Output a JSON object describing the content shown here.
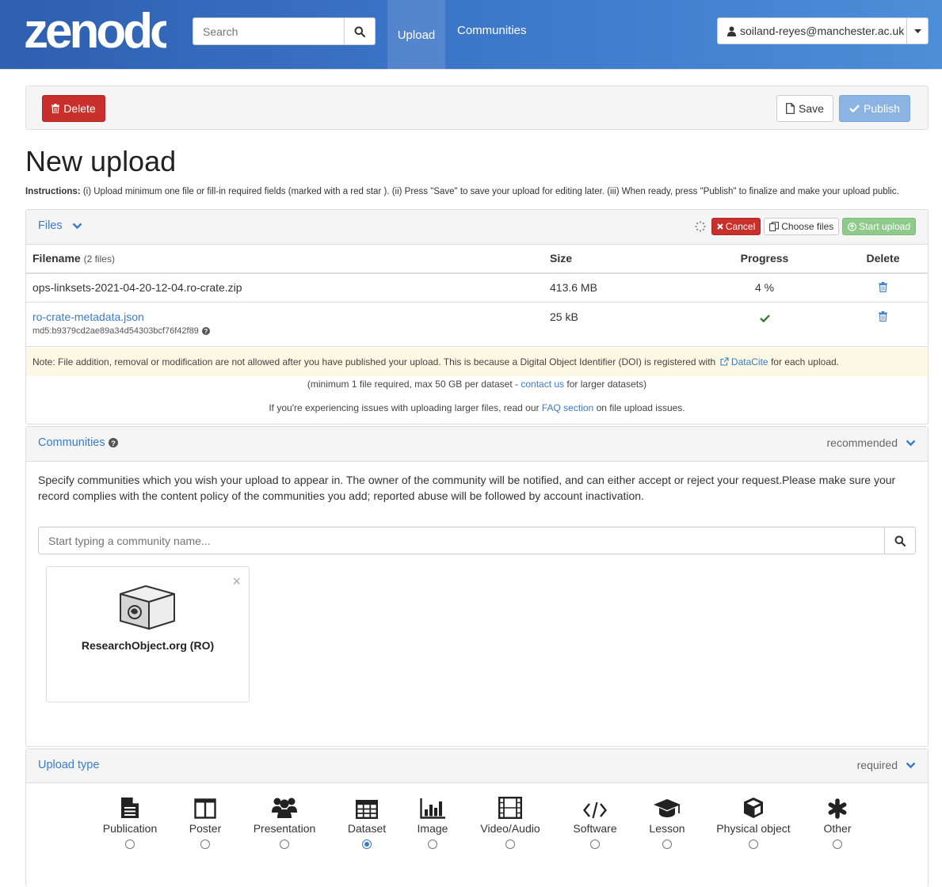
{
  "header": {
    "logo_text": "zenodo",
    "search_placeholder": "Search",
    "nav_upload": "Upload",
    "nav_communities": "Communities",
    "user_email": "soiland-reyes@manchester.ac.uk"
  },
  "actions": {
    "delete_label": "Delete",
    "save_label": "Save",
    "publish_label": "Publish"
  },
  "page": {
    "title": "New upload",
    "instructions_label": "Instructions:",
    "instructions_text": "(i) Upload minimum one file or fill-in required fields (marked with a red star ). (ii) Press \"Save\" to save your upload for editing later. (iii) When ready, press \"Publish\" to finalize and make your upload public."
  },
  "files": {
    "panel_title": "Files",
    "cancel_label": "Cancel",
    "choose_label": "Choose files",
    "start_label": "Start upload",
    "columns": {
      "filename": "Filename",
      "filecount": "(2 files)",
      "size": "Size",
      "progress": "Progress",
      "delete": "Delete"
    },
    "rows": [
      {
        "name": "ops-linksets-2021-04-20-12-04.ro-crate.zip",
        "size": "413.6 MB",
        "progress": "4 %"
      },
      {
        "name": "ro-crate-metadata.json",
        "md5": "md5:b9379cd2ae89a34d54303bcf76f42f89",
        "size": "25 kB",
        "progress": "done"
      }
    ],
    "note_prefix": "Note: File addition, removal or modification are not allowed after you have published your upload. This is because a Digital Object Identifier (DOI) is registered with",
    "note_link": "DataCite",
    "note_suffix": "for each upload.",
    "limits_prefix": "(minimum 1 file required, max 50 GB per dataset -",
    "limits_link": "contact us",
    "limits_suffix": "for larger datasets)",
    "issues_prefix": "If you're experiencing issues with uploading larger files, read our",
    "issues_link": "FAQ section",
    "issues_suffix": "on file upload issues."
  },
  "communities": {
    "panel_title": "Communities",
    "status": "recommended",
    "description": "Specify communities which you wish your upload to appear in. The owner of the community will be notified, and can either accept or reject your request.Please make sure your record complies with the content policy of the communities you add; reported abuse will be followed by account inactivation.",
    "search_placeholder": "Start typing a community name...",
    "selected": [
      {
        "name": "ResearchObject.org (RO)"
      }
    ]
  },
  "upload_type": {
    "panel_title": "Upload type",
    "status": "required",
    "options": [
      {
        "label": "Publication",
        "icon": "file-icon",
        "selected": false
      },
      {
        "label": "Poster",
        "icon": "columns-icon",
        "selected": false
      },
      {
        "label": "Presentation",
        "icon": "group-icon",
        "selected": false
      },
      {
        "label": "Dataset",
        "icon": "table-icon",
        "selected": true
      },
      {
        "label": "Image",
        "icon": "bar-chart-icon",
        "selected": false
      },
      {
        "label": "Video/Audio",
        "icon": "film-icon",
        "selected": false
      },
      {
        "label": "Software",
        "icon": "code-icon",
        "selected": false
      },
      {
        "label": "Lesson",
        "icon": "graduation-cap-icon",
        "selected": false
      },
      {
        "label": "Physical object",
        "icon": "cube-icon",
        "selected": false
      },
      {
        "label": "Other",
        "icon": "asterisk-icon",
        "selected": false
      }
    ]
  },
  "colors": {
    "brand_blue": "#3a7bc8",
    "danger": "#c9302c",
    "success": "#8fc98c",
    "note_bg": "#fcf8e3"
  }
}
